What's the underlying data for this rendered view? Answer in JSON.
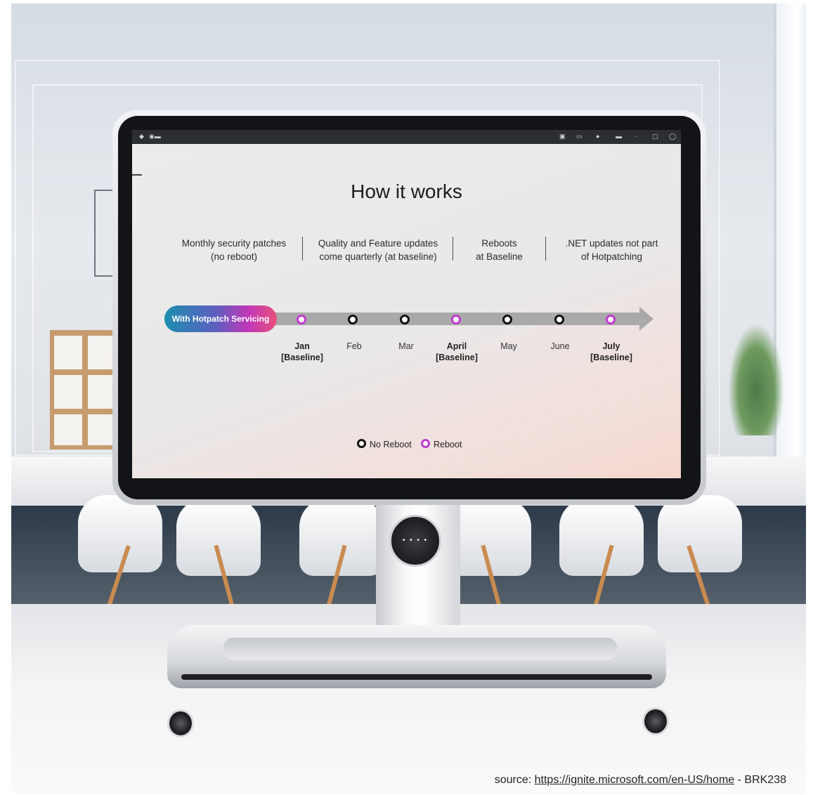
{
  "slide": {
    "title": "How it works",
    "columns": [
      {
        "line1": "Monthly security patches",
        "line2": "(no reboot)"
      },
      {
        "line1": "Quality and Feature updates",
        "line2": "come quarterly (at baseline)"
      },
      {
        "line1": "Reboots",
        "line2": "at Baseline"
      },
      {
        "line1": ".NET updates not part",
        "line2": "of Hotpatching"
      }
    ],
    "timeline_label": "With Hotpatch Servicing",
    "months": [
      {
        "label": "Jan",
        "sub": "[Baseline]",
        "reboot": true
      },
      {
        "label": "Feb",
        "sub": "",
        "reboot": false
      },
      {
        "label": "Mar",
        "sub": "",
        "reboot": false
      },
      {
        "label": "April",
        "sub": "[Baseline]",
        "reboot": true
      },
      {
        "label": "May",
        "sub": "",
        "reboot": false
      },
      {
        "label": "June",
        "sub": "",
        "reboot": false
      },
      {
        "label": "July",
        "sub": "[Baseline]",
        "reboot": true
      }
    ],
    "legend": {
      "no_reboot": "No Reboot",
      "reboot": "Reboot"
    },
    "colors": {
      "reboot": "#c03ad1",
      "no_reboot": "#111111",
      "arrow": "#a9a9a9"
    }
  },
  "caption": {
    "prefix": "source: ",
    "link": "https://ignite.microsoft.com/en-US/home",
    "suffix": " - BRK238"
  }
}
